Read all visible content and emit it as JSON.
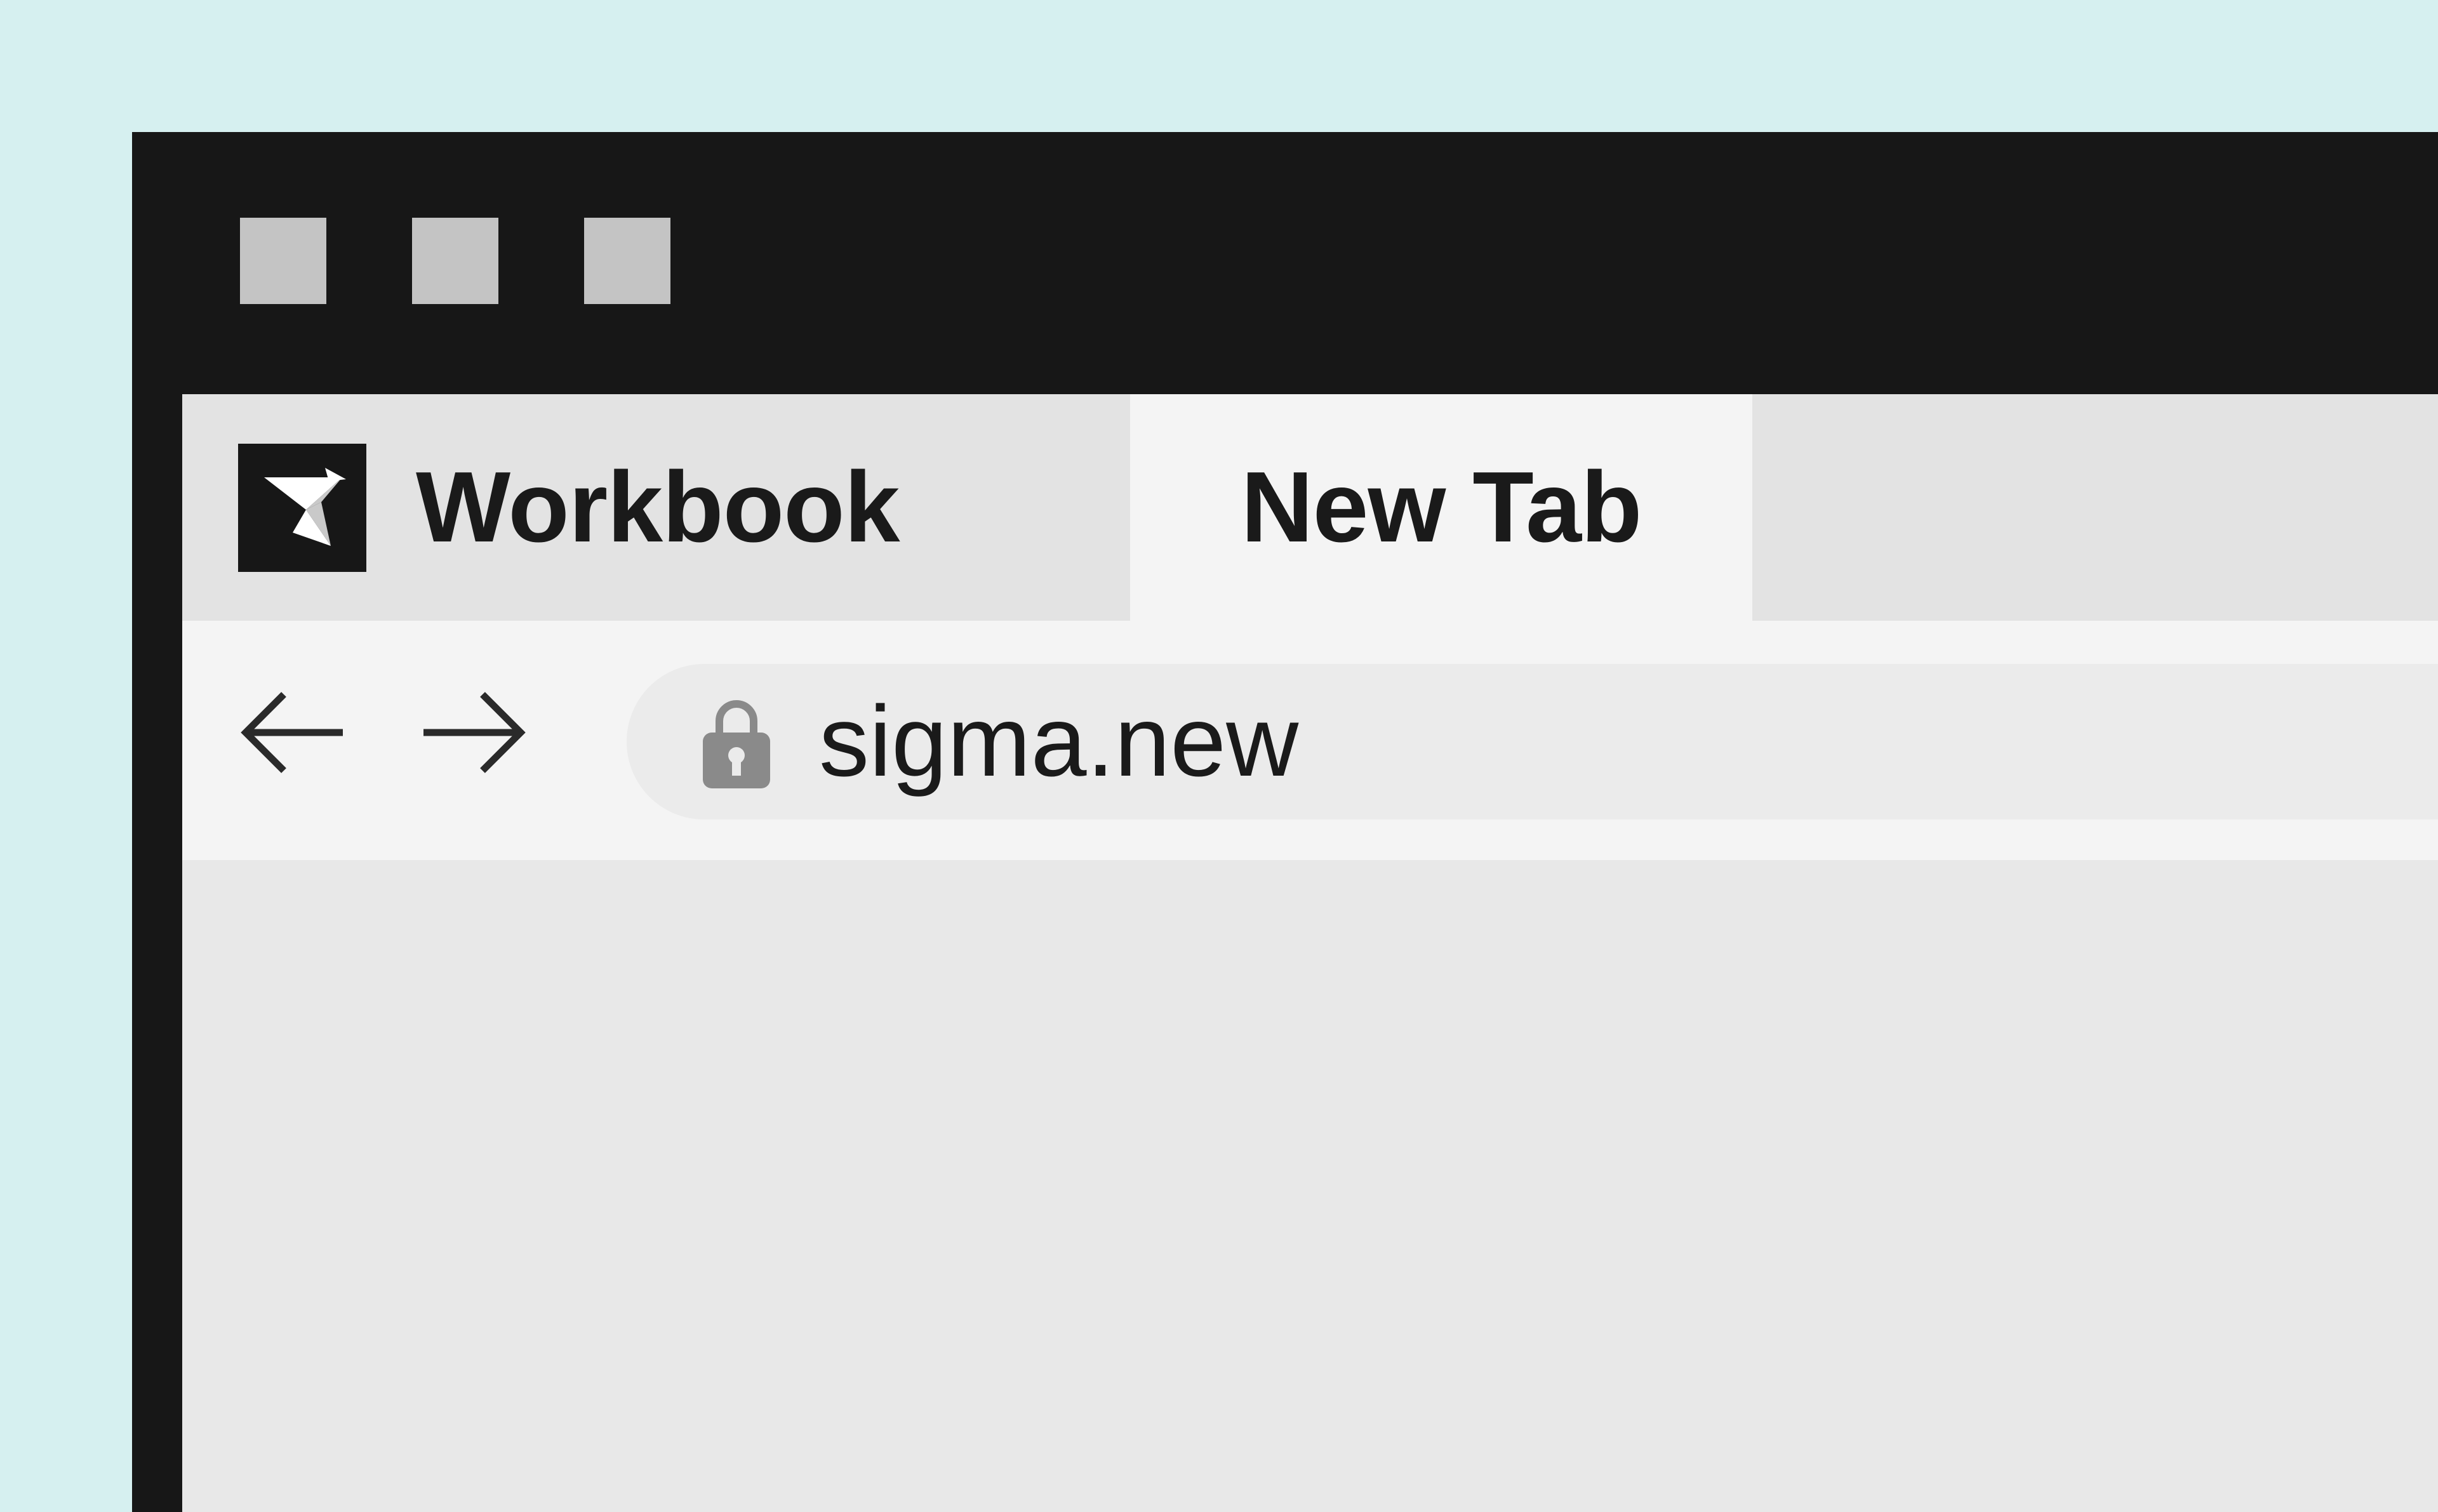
{
  "window": {
    "controls": [
      "control-1",
      "control-2",
      "control-3"
    ]
  },
  "tabs": [
    {
      "label": "Workbook",
      "icon": "sigma-logo-icon",
      "active": false
    },
    {
      "label": "New Tab",
      "active": true
    }
  ],
  "toolbar": {
    "back_icon": "arrow-left-icon",
    "forward_icon": "arrow-right-icon",
    "lock_icon": "lock-icon",
    "url": "sigma.new"
  },
  "colors": {
    "background": "#d6f0f0",
    "window_frame": "#171717",
    "window_button": "#c4c4c4",
    "tab_inactive": "#e3e3e3",
    "tab_active": "#f4f4f4",
    "toolbar": "#f4f4f4",
    "address_bar": "#ebebeb",
    "content": "#e8e8e8",
    "lock": "#8a8a8a"
  }
}
